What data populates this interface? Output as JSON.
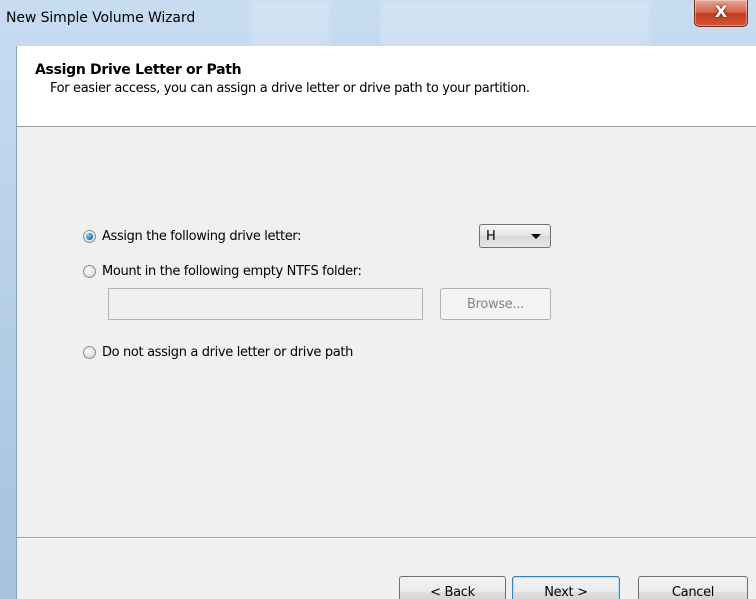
{
  "window": {
    "title": "New Simple Volume Wizard",
    "close_glyph": "X"
  },
  "header": {
    "title": "Assign Drive Letter or Path",
    "subtitle": "For easier access, you can assign a drive letter or drive path to your partition."
  },
  "options": {
    "assign_letter": {
      "label": "Assign the following drive letter:",
      "checked": true
    },
    "mount_folder": {
      "label": "Mount in the following empty NTFS folder:",
      "checked": false
    },
    "no_assign": {
      "label": "Do not assign a drive letter or drive path",
      "checked": false
    }
  },
  "drive_letter": {
    "selected": "H"
  },
  "folder_path": {
    "value": ""
  },
  "buttons": {
    "browse": "Browse...",
    "back": "< Back",
    "next": "Next >",
    "cancel": "Cancel"
  },
  "icons": {
    "close": "close-icon",
    "dropdown": "chevron-down-icon"
  }
}
